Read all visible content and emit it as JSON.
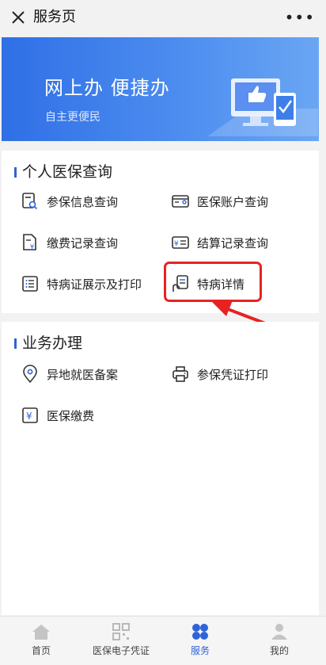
{
  "header": {
    "title": "服务页",
    "more": "•••"
  },
  "banner": {
    "title": "网上办 便捷办",
    "subtitle": "自主更便民"
  },
  "section1": {
    "title": "个人医保查询",
    "items": [
      {
        "label": "参保信息查询",
        "icon": "document-search-icon"
      },
      {
        "label": "医保账户查询",
        "icon": "account-card-icon"
      },
      {
        "label": "缴费记录查询",
        "icon": "payment-record-icon"
      },
      {
        "label": "结算记录查询",
        "icon": "settlement-record-icon"
      },
      {
        "label": "特病证展示及打印",
        "icon": "list-icon"
      },
      {
        "label": "特病详情",
        "icon": "hand-document-icon"
      }
    ]
  },
  "section2": {
    "title": "业务办理",
    "items": [
      {
        "label": "异地就医备案",
        "icon": "location-pin-icon"
      },
      {
        "label": "参保凭证打印",
        "icon": "printer-icon"
      },
      {
        "label": "医保缴费",
        "icon": "yuan-payment-icon"
      }
    ]
  },
  "tabbar": {
    "tabs": [
      {
        "label": "首页",
        "icon": "home-icon",
        "active": false
      },
      {
        "label": "医保电子凭证",
        "icon": "qr-code-icon",
        "active": false
      },
      {
        "label": "服务",
        "icon": "clover-icon",
        "active": true
      },
      {
        "label": "我的",
        "icon": "user-icon",
        "active": false
      }
    ]
  },
  "colors": {
    "accent": "#2f63d8",
    "banner": "#3f7fec",
    "highlight": "#e82222"
  }
}
